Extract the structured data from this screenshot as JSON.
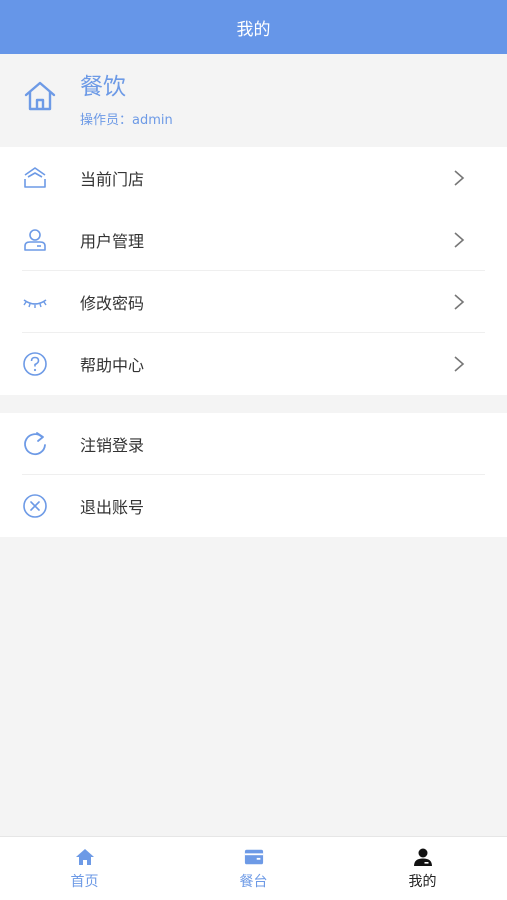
{
  "header": {
    "title": "我的"
  },
  "profile": {
    "name": "餐饮",
    "operator": "操作员：admin"
  },
  "menu_group_1": [
    {
      "label": "当前门店",
      "icon": "shop-icon"
    },
    {
      "label": "用户管理",
      "icon": "user-icon"
    },
    {
      "label": "修改密码",
      "icon": "eye-closed-icon"
    },
    {
      "label": "帮助中心",
      "icon": "help-icon"
    }
  ],
  "menu_group_2": [
    {
      "label": "注销登录",
      "icon": "refresh-icon"
    },
    {
      "label": "退出账号",
      "icon": "close-circle-icon"
    }
  ],
  "tabs": [
    {
      "label": "首页",
      "icon": "home-icon"
    },
    {
      "label": "餐台",
      "icon": "table-icon"
    },
    {
      "label": "我的",
      "icon": "person-icon",
      "active": true
    }
  ],
  "colors": {
    "primary": "#6696e8",
    "accent": "#6d9ae6",
    "text": "#333333",
    "background": "#f4f4f4"
  }
}
